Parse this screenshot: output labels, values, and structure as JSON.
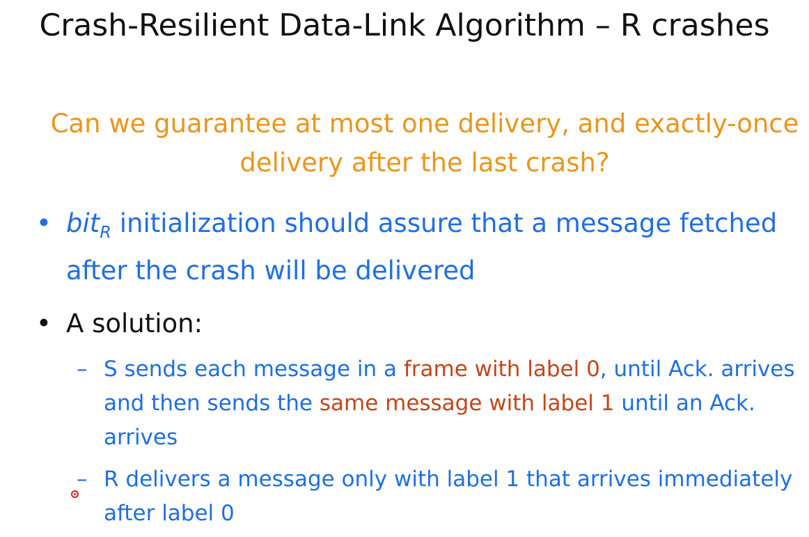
{
  "title": "Crash-Resilient Data-Link Algorithm – R crashes",
  "question": "Can we guarantee at most one delivery, and exactly-once delivery after the last crash?",
  "bullets": [
    {
      "marker": "•",
      "var": "bit",
      "var_sub": "R",
      "text": " initialization should assure that a message fetched after the crash will be delivered"
    },
    {
      "marker": "•",
      "text": "A solution:"
    }
  ],
  "subbullets": [
    {
      "marker": "–",
      "p1": "S sends each message in a ",
      "h1": "frame with label 0",
      "p2": ", until Ack. arrives and then sends the ",
      "h2": "same message with label 1",
      "p3": " until an Ack. arrives"
    },
    {
      "marker": "–",
      "text": "R delivers a message only with label 1 that arrives immediately after label 0"
    }
  ],
  "colors": {
    "title": "#111111",
    "question": "#e8961e",
    "blue": "#1f6fe0",
    "highlight": "#c2461a",
    "pointer": "#d81b2a"
  },
  "icons": {
    "pointer": "laser-pointer-dot-icon"
  }
}
